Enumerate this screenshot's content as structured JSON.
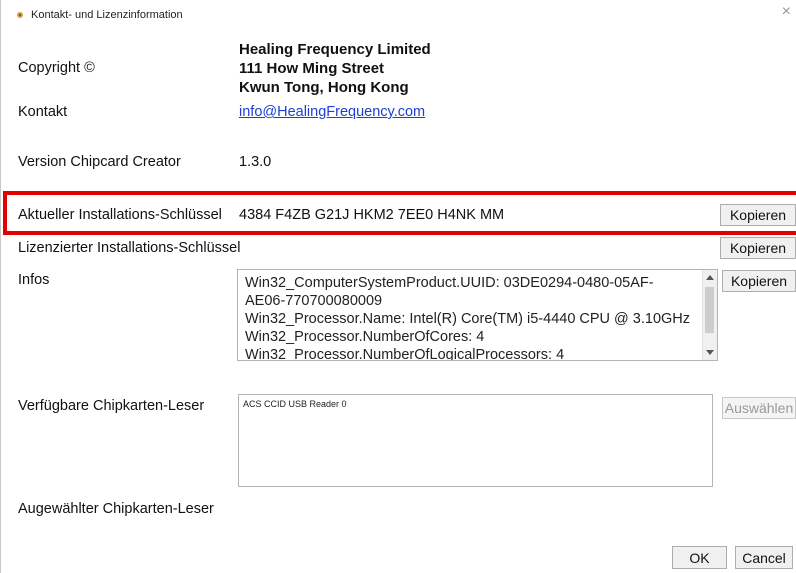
{
  "window": {
    "title": "Kontakt- und Lizenzinformation",
    "close_glyph": "×"
  },
  "copyright": {
    "label": "Copyright ©",
    "company_lines": [
      "Healing Frequency Limited",
      "111 How Ming Street",
      "Kwun Tong, Hong Kong"
    ]
  },
  "contact": {
    "label": "Kontakt",
    "email": "info@HealingFrequency.com"
  },
  "version": {
    "label": "Version Chipcard Creator",
    "value": "1.3.0"
  },
  "current_key": {
    "label": "Aktueller Installations-Schlüssel",
    "value": "4384 F4ZB G21J HKM2 7EE0 H4NK MM",
    "copy_label": "Kopieren"
  },
  "licensed_key": {
    "label": "Lizenzierter Installations-Schlüssel",
    "value": "",
    "copy_label": "Kopieren"
  },
  "infos": {
    "label": "Infos",
    "lines": [
      "Win32_ComputerSystemProduct.UUID: 03DE0294-0480-05AF-",
      "AE06-770700080009",
      "Win32_Processor.Name: Intel(R) Core(TM) i5-4440 CPU @ 3.10GHz",
      "Win32_Processor.NumberOfCores: 4",
      "Win32_Processor.NumberOfLogicalProcessors: 4"
    ],
    "copy_label": "Kopieren"
  },
  "readers": {
    "label": "Verfügbare Chipkarten-Leser",
    "items": [
      "ACS CCID USB Reader 0"
    ],
    "select_label": "Auswählen"
  },
  "selected_reader": {
    "label": "Augewählter Chipkarten-Leser",
    "value": ""
  },
  "footer": {
    "ok_label": "OK",
    "cancel_label": "Cancel"
  },
  "colors": {
    "highlight": "#e50000",
    "link": "#1a3fd4"
  }
}
